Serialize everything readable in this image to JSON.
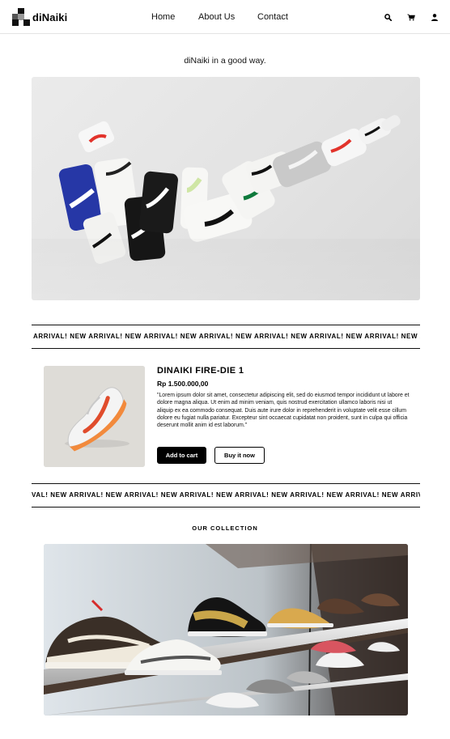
{
  "brand": {
    "name": "diNaiki"
  },
  "nav": {
    "links": [
      "Home",
      "About Us",
      "Contact"
    ],
    "icons": [
      "search-icon",
      "cart-icon",
      "user-icon"
    ]
  },
  "tagline": "diNaiki in a good way.",
  "marquee": {
    "text_top": "ARRIVAL! NEW ARRIVAL! NEW ARRIVAL! NEW ARRIVAL! NEW ARRIVAL! NEW ARRIVAL! NEW ARRIVAL! NEW ARRIVAL! NEW",
    "text_bottom": "VAL! NEW ARRIVAL! NEW ARRIVAL! NEW ARRIVAL! NEW ARRIVAL! NEW ARRIVAL! NEW ARRIVAL! NEW ARRIVAL! NEW ARRIVAL!"
  },
  "product": {
    "title": "DINAIKI FIRE-DIE 1",
    "price": "Rp 1.500.000,00",
    "description": "\"Lorem ipsum dolor sit amet, consectetur adipiscing elit, sed do eiusmod tempor incididunt ut labore et dolore magna aliqua. Ut enim ad minim veniam, quis nostrud exercitation ullamco laboris nisi ut aliquip ex ea commodo consequat. Duis aute irure dolor in reprehenderit in voluptate velit esse cillum dolore eu fugiat nulla pariatur. Excepteur sint occaecat cupidatat non proident, sunt in culpa qui officia deserunt mollit anim id est laborum.\"",
    "add_to_cart": "Add to cart",
    "buy_now": "Buy it now"
  },
  "collection": {
    "title": "OUR COLLECTION"
  }
}
